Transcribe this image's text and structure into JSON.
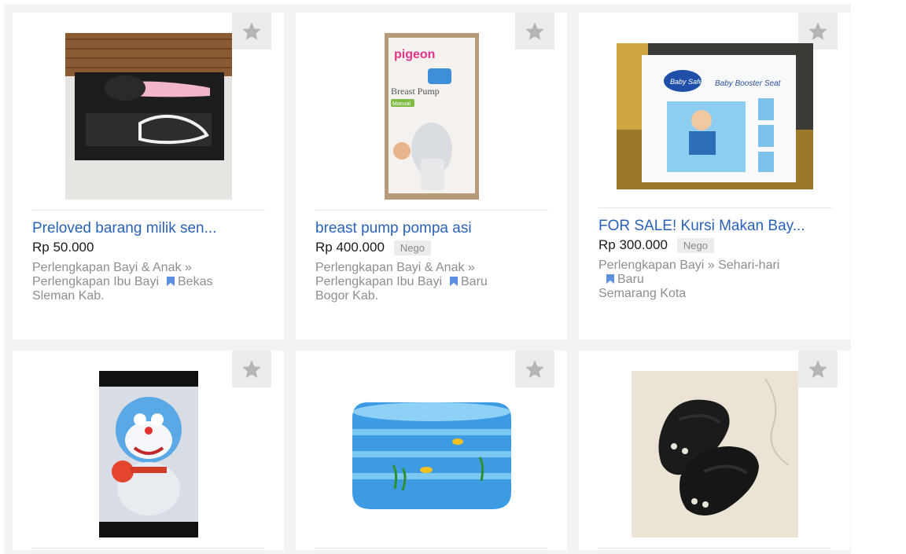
{
  "listings": [
    {
      "title": "Preloved barang milik sen...",
      "price": "Rp 50.000",
      "nego": "",
      "category_line1": "Perlengkapan Bayi & Anak »",
      "category_line2": "Perlengkapan Ibu Bayi",
      "condition": "Bekas",
      "location": "Sleman Kab."
    },
    {
      "title": "breast pump pompa asi",
      "price": "Rp 400.000",
      "nego": "Nego",
      "category_line1": "Perlengkapan Bayi & Anak »",
      "category_line2": "Perlengkapan Ibu Bayi",
      "condition": "Baru",
      "location": "Bogor Kab.",
      "image_text": {
        "brand": "pigeon",
        "product": "Breast Pump",
        "sub": "Manual"
      }
    },
    {
      "title": "FOR SALE! Kursi Makan Bay...",
      "price": "Rp 300.000",
      "nego": "Nego",
      "category_line1": "Perlengkapan Bayi » Sehari-hari",
      "condition": "Baru",
      "location": "Semarang Kota",
      "image_text": {
        "brand": "Baby Safe",
        "product": "Baby Booster Seat"
      }
    },
    {
      "title": "",
      "price": ""
    },
    {
      "title": "",
      "price": ""
    },
    {
      "title": "",
      "price": ""
    }
  ],
  "icons": {
    "favorite": "star-icon",
    "condition": "bookmark-icon"
  },
  "colors": {
    "link": "#2a62b9",
    "muted": "#8e8e8e",
    "bookmark": "#5b8fe0"
  }
}
